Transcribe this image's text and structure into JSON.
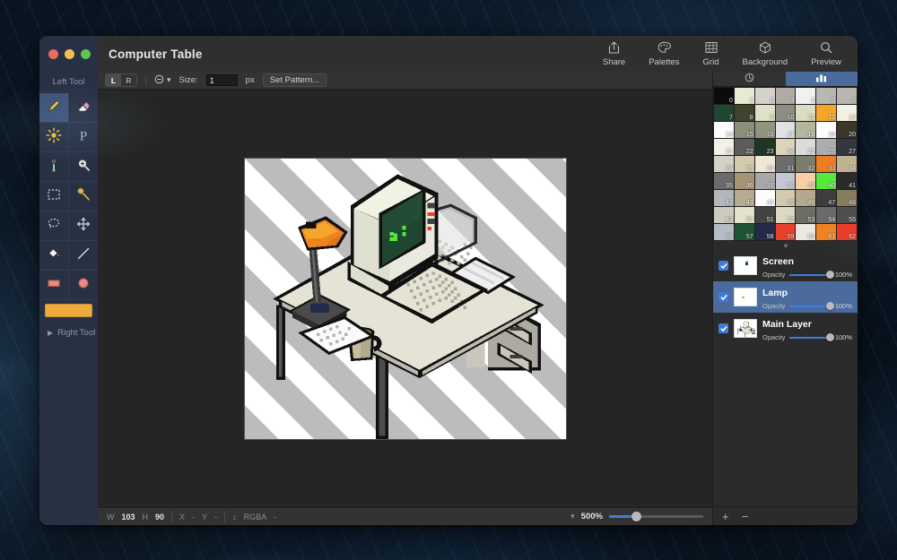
{
  "window": {
    "document_title": "Computer Table",
    "traffic_lights": [
      "close-button",
      "minimize-button",
      "maximize-button"
    ]
  },
  "toolbar": {
    "items": [
      {
        "label": "Share",
        "icon": "share-icon"
      },
      {
        "label": "Palettes",
        "icon": "palette-icon"
      },
      {
        "label": "Grid",
        "icon": "grid-icon"
      },
      {
        "label": "Background",
        "icon": "cube-icon"
      },
      {
        "label": "Preview",
        "icon": "magnifier-icon"
      }
    ]
  },
  "left_sidebar": {
    "header": "Left Tool",
    "footer": "Right Tool",
    "selected_tool": "pencil",
    "tools": [
      {
        "name": "pencil-tool",
        "icon": "pencil-icon",
        "selected": true
      },
      {
        "name": "eraser-tool",
        "icon": "eraser-icon",
        "selected": false
      },
      {
        "name": "dither-tool",
        "icon": "sun-icon",
        "selected": false
      },
      {
        "name": "pen-tool",
        "icon": "p-letter-icon",
        "selected": false
      },
      {
        "name": "eyedropper-tool",
        "icon": "eyedropper-icon",
        "selected": false
      },
      {
        "name": "zoom-tool",
        "icon": "zoom-in-icon",
        "selected": false
      },
      {
        "name": "rect-select-tool",
        "icon": "marquee-icon",
        "selected": false
      },
      {
        "name": "magic-wand-tool",
        "icon": "magic-wand-icon",
        "selected": false
      },
      {
        "name": "lasso-select-tool",
        "icon": "lasso-icon",
        "selected": false
      },
      {
        "name": "move-tool",
        "icon": "move-arrows-icon",
        "selected": false
      },
      {
        "name": "paint-bucket-tool",
        "icon": "paint-bucket-icon",
        "selected": false
      },
      {
        "name": "line-tool",
        "icon": "line-icon",
        "selected": false
      },
      {
        "name": "rectangle-tool",
        "icon": "rectangle-icon",
        "selected": false
      },
      {
        "name": "ellipse-tool",
        "icon": "ellipse-icon",
        "selected": false
      }
    ],
    "color_swatch": "#eeab3d"
  },
  "options_bar": {
    "left_button": "L",
    "right_button": "R",
    "active_button": "L",
    "shape_icon": "minus-circle-icon",
    "size_label": "Size:",
    "size_value": "1",
    "size_unit": "px",
    "pattern_button": "Set Pattern..."
  },
  "status_bar": {
    "width_label": "W",
    "width_value": "103",
    "height_label": "H",
    "height_value": "90",
    "x_label": "X",
    "x_value": "-",
    "y_label": "Y",
    "y_value": "-",
    "color_mode": "RGBA",
    "color_value": "-",
    "zoom_value": "500%"
  },
  "palette_panel": {
    "tabs": [
      {
        "name": "history-tab",
        "icon": "clock-icon",
        "selected": false
      },
      {
        "name": "palette-tab",
        "icon": "bars-icon",
        "selected": true
      }
    ],
    "swatches": [
      {
        "index": "0",
        "color": "#0b0b0b"
      },
      {
        "index": "1",
        "color": "#e8ead2"
      },
      {
        "index": "2",
        "color": "#d5d2cb"
      },
      {
        "index": "3",
        "color": "#b0aca5"
      },
      {
        "index": "4",
        "color": "#f1f1f1"
      },
      {
        "index": "5",
        "color": "#b8b7b1"
      },
      {
        "index": "6",
        "color": "#b9b6af"
      },
      {
        "index": "7",
        "color": "#1f4630"
      },
      {
        "index": "8",
        "color": "#41432f"
      },
      {
        "index": "9",
        "color": "#dfe0c8"
      },
      {
        "index": "10",
        "color": "#8e8d84"
      },
      {
        "index": "11",
        "color": "#dcdcc2"
      },
      {
        "index": "12",
        "color": "#f4a62a"
      },
      {
        "index": "13",
        "color": "#f3f2e2"
      },
      {
        "index": "14",
        "color": "#fcfcff"
      },
      {
        "index": "15",
        "color": "#8a8e7a"
      },
      {
        "index": "16",
        "color": "#92947e"
      },
      {
        "index": "17",
        "color": "#dfe1e3"
      },
      {
        "index": "18",
        "color": "#b2b79d"
      },
      {
        "index": "19",
        "color": "#ffffff"
      },
      {
        "index": "20",
        "color": "#3b3629"
      },
      {
        "index": "21",
        "color": "#f3f1e6"
      },
      {
        "index": "22",
        "color": "#5c5c5c"
      },
      {
        "index": "23",
        "color": "#1f3526"
      },
      {
        "index": "24",
        "color": "#ddd4bb"
      },
      {
        "index": "25",
        "color": "#dcdcdc"
      },
      {
        "index": "26",
        "color": "#adadad"
      },
      {
        "index": "27",
        "color": "#35363f"
      },
      {
        "index": "28",
        "color": "#d4d2c6"
      },
      {
        "index": "29",
        "color": "#d4c9ad"
      },
      {
        "index": "30",
        "color": "#efe8d6"
      },
      {
        "index": "31",
        "color": "#6c6c6c"
      },
      {
        "index": "32",
        "color": "#7c7d6d"
      },
      {
        "index": "33",
        "color": "#ee7c20"
      },
      {
        "index": "34",
        "color": "#c0b393"
      },
      {
        "index": "35",
        "color": "#6b6b6b"
      },
      {
        "index": "36",
        "color": "#a59575"
      },
      {
        "index": "37",
        "color": "#a8a8a8"
      },
      {
        "index": "38",
        "color": "#c3c7d1"
      },
      {
        "index": "39",
        "color": "#f6cfa7"
      },
      {
        "index": "40",
        "color": "#56e83a"
      },
      {
        "index": "41",
        "color": "#2b2b2b"
      },
      {
        "index": "42",
        "color": "#b3b7bb"
      },
      {
        "index": "43",
        "color": "#b6ab91"
      },
      {
        "index": "44",
        "color": "#fdfdfd"
      },
      {
        "index": "45",
        "color": "#d3c9ae"
      },
      {
        "index": "46",
        "color": "#b3a98e"
      },
      {
        "index": "47",
        "color": "#3d3d3d"
      },
      {
        "index": "48",
        "color": "#897c5e"
      },
      {
        "index": "49",
        "color": "#cdcbbc"
      },
      {
        "index": "50",
        "color": "#e3e3cd"
      },
      {
        "index": "51",
        "color": "#434343"
      },
      {
        "index": "52",
        "color": "#dcd8c2"
      },
      {
        "index": "53",
        "color": "#6e6e66"
      },
      {
        "index": "54",
        "color": "#6a6a6a"
      },
      {
        "index": "55",
        "color": "#4e4e4e"
      },
      {
        "index": "56",
        "color": "#b6bcc4"
      },
      {
        "index": "57",
        "color": "#1d5633"
      },
      {
        "index": "58",
        "color": "#232a4a"
      },
      {
        "index": "59",
        "color": "#e8402a"
      },
      {
        "index": "60",
        "color": "#ece9e0"
      },
      {
        "index": "61",
        "color": "#ee8420"
      },
      {
        "index": "62",
        "color": "#ec3b26"
      }
    ]
  },
  "layers_panel": {
    "opacity_label": "Opacity",
    "layers": [
      {
        "name": "Screen",
        "visible": true,
        "opacity": "100%",
        "selected": false,
        "thumb": "green-dot"
      },
      {
        "name": "Lamp",
        "visible": true,
        "opacity": "100%",
        "selected": true,
        "thumb": "orange-dot"
      },
      {
        "name": "Main Layer",
        "visible": true,
        "opacity": "100%",
        "selected": false,
        "thumb": "computer-desk"
      }
    ],
    "add_button": "+",
    "remove_button": "−"
  },
  "canvas": {
    "name": "pixel-art-canvas",
    "content_description": "Isometric pixel art of a retro computer on a desk with CRT monitor, keyboard, orange desk lamp, mug and papers",
    "transparency_pattern": "diagonal-stripes"
  }
}
